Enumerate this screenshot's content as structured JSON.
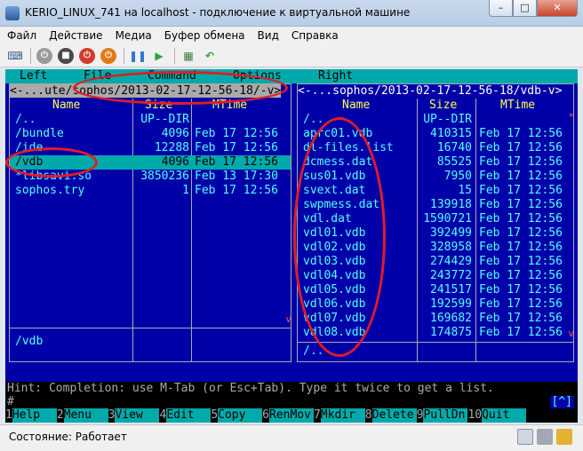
{
  "window": {
    "title": "KERIO_LINUX_741 на localhost - подключение к виртуальной машине"
  },
  "menubar": [
    "Файл",
    "Действие",
    "Медиа",
    "Буфер обмена",
    "Вид",
    "Справка"
  ],
  "toolbar": {
    "icons": [
      "ctrl-alt-del-icon",
      "start-icon",
      "turn-off-icon",
      "shutdown-icon",
      "power-icon",
      "pause-icon",
      "play-icon",
      "snapshot-icon",
      "revert-icon"
    ]
  },
  "mc": {
    "menu": [
      "Left",
      "File",
      "Command",
      "Options",
      "Right"
    ],
    "left": {
      "path": "<-...ute/sophos/2013-02-17-12-56-18/-v>",
      "headers": {
        "name": "Name",
        "size": "Size",
        "mtime": "MTime"
      },
      "rows": [
        {
          "name": "/..",
          "size": "UP--DIR",
          "mtime": ""
        },
        {
          "name": "/bundle",
          "size": "4096",
          "mtime": "Feb 17 12:56"
        },
        {
          "name": "/ide",
          "size": "12288",
          "mtime": "Feb 17 12:56"
        },
        {
          "name": "/vdb",
          "size": "4096",
          "mtime": "Feb 17 12:56"
        },
        {
          "name": "*libsavi.so",
          "size": "3850236",
          "mtime": "Feb 13 17:30"
        },
        {
          "name": " sophos.try",
          "size": "1",
          "mtime": "Feb 17 12:56"
        }
      ],
      "selected_index": 3,
      "mini_status": "/vdb"
    },
    "right": {
      "path": "<-...sophos/2013-02-17-12-56-18/vdb-v>",
      "headers": {
        "name": "Name",
        "size": "Size",
        "mtime": "MTime"
      },
      "rows": [
        {
          "name": "/..",
          "size": "UP--DIR",
          "mtime": ""
        },
        {
          "name": " aprc01.vdb",
          "size": "410315",
          "mtime": "Feb 17 12:56"
        },
        {
          "name": " dl-files.list",
          "size": "16740",
          "mtime": "Feb 17 12:56"
        },
        {
          "name": " dcmess.dat",
          "size": "85525",
          "mtime": "Feb 17 12:56"
        },
        {
          "name": " sus01.vdb",
          "size": "7950",
          "mtime": "Feb 17 12:56"
        },
        {
          "name": " svext.dat",
          "size": "15",
          "mtime": "Feb 17 12:56"
        },
        {
          "name": " swpmess.dat",
          "size": "139918",
          "mtime": "Feb 17 12:56"
        },
        {
          "name": " vdl.dat",
          "size": "1590721",
          "mtime": "Feb 17 12:56"
        },
        {
          "name": " vdl01.vdb",
          "size": "392499",
          "mtime": "Feb 17 12:56"
        },
        {
          "name": " vdl02.vdb",
          "size": "328958",
          "mtime": "Feb 17 12:56"
        },
        {
          "name": " vdl03.vdb",
          "size": "274429",
          "mtime": "Feb 17 12:56"
        },
        {
          "name": " vdl04.vdb",
          "size": "243772",
          "mtime": "Feb 17 12:56"
        },
        {
          "name": " vdl05.vdb",
          "size": "241517",
          "mtime": "Feb 17 12:56"
        },
        {
          "name": " vdl06.vdb",
          "size": "192599",
          "mtime": "Feb 17 12:56"
        },
        {
          "name": " vdl07.vdb",
          "size": "169682",
          "mtime": "Feb 17 12:56"
        },
        {
          "name": " vdl08.vdb",
          "size": "174875",
          "mtime": "Feb 17 12:56"
        }
      ],
      "mini_status": "/.."
    },
    "hint": "Hint: Completion: use M-Tab (or Esc+Tab).  Type it twice to get a list.",
    "prompt": "#",
    "prompt_flag": "[^]",
    "fkeys": [
      {
        "num": "1",
        "label": "Help"
      },
      {
        "num": "2",
        "label": "Menu"
      },
      {
        "num": "3",
        "label": "View"
      },
      {
        "num": "4",
        "label": "Edit"
      },
      {
        "num": "5",
        "label": "Copy"
      },
      {
        "num": "6",
        "label": "RenMov"
      },
      {
        "num": "7",
        "label": "Mkdir"
      },
      {
        "num": "8",
        "label": "Delete"
      },
      {
        "num": "9",
        "label": "PullDn"
      },
      {
        "num": "10",
        "label": "Quit"
      }
    ]
  },
  "statusbar": {
    "text": "Состояние: Работает"
  },
  "colors": {
    "terminal_bg": "#0000a8",
    "selection": "#00aaaa",
    "annotation": "#e21c24"
  }
}
